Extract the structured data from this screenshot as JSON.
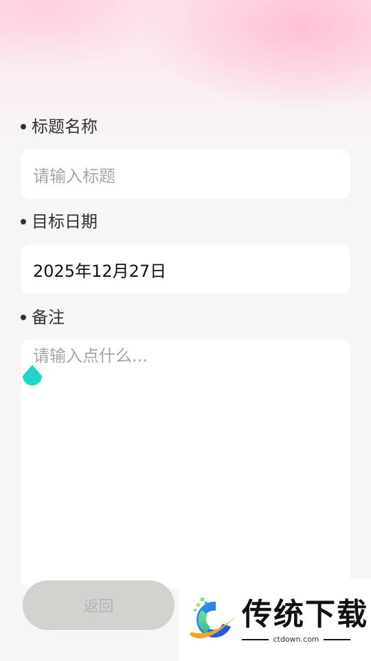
{
  "form": {
    "title_label": "标题名称",
    "title_placeholder": "请输入标题",
    "date_label": "目标日期",
    "date_value": "2025年12月27日",
    "note_label": "备注",
    "note_placeholder": "请输入点什么..."
  },
  "actions": {
    "back_label": "返回"
  },
  "watermark": {
    "name": "传统下载",
    "url": "ctdown.com"
  },
  "colors": {
    "accent_cursor": "#1ed6c6",
    "button_bg": "#d3d2ce",
    "button_text": "#b2b5c0",
    "background": "#f8f5f6"
  }
}
